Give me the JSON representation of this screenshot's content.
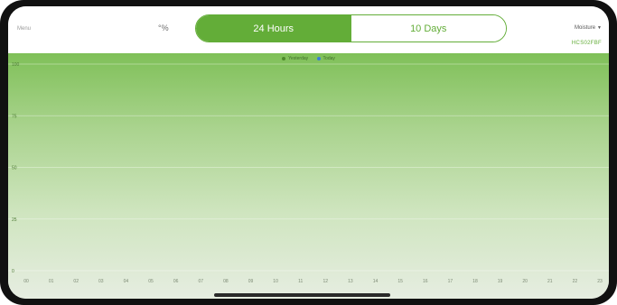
{
  "header": {
    "menu_label": "Menu",
    "unit_toggle": "°%",
    "tabs": [
      {
        "label": "24 Hours",
        "active": true
      },
      {
        "label": "10 Days",
        "active": false
      }
    ],
    "metric": "Moisture",
    "device_id": "HCS02FBF"
  },
  "colors": {
    "accent": "#63ad38",
    "yesterday": "#4e8a2d",
    "today": "#3b7fd6"
  },
  "chart_data": {
    "type": "line",
    "legend_position": "top-center",
    "grid": true,
    "ylim": [
      0,
      100
    ],
    "yticks": [
      "100",
      "75",
      "50",
      "25",
      "0"
    ],
    "categories": [
      "00",
      "01",
      "02",
      "03",
      "04",
      "05",
      "06",
      "07",
      "08",
      "09",
      "10",
      "11",
      "12",
      "13",
      "14",
      "15",
      "16",
      "17",
      "18",
      "19",
      "20",
      "21",
      "22",
      "23"
    ],
    "series": [
      {
        "name": "Yesterday",
        "values": []
      },
      {
        "name": "Today",
        "values": []
      }
    ]
  }
}
